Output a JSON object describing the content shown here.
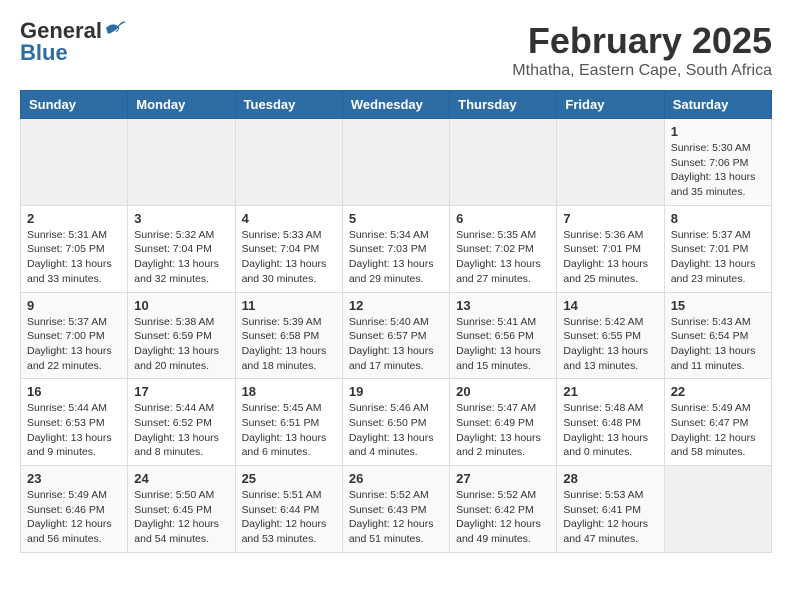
{
  "header": {
    "logo_general": "General",
    "logo_blue": "Blue",
    "month_title": "February 2025",
    "location": "Mthatha, Eastern Cape, South Africa"
  },
  "weekdays": [
    "Sunday",
    "Monday",
    "Tuesday",
    "Wednesday",
    "Thursday",
    "Friday",
    "Saturday"
  ],
  "weeks": [
    [
      {
        "day": "",
        "info": ""
      },
      {
        "day": "",
        "info": ""
      },
      {
        "day": "",
        "info": ""
      },
      {
        "day": "",
        "info": ""
      },
      {
        "day": "",
        "info": ""
      },
      {
        "day": "",
        "info": ""
      },
      {
        "day": "1",
        "info": "Sunrise: 5:30 AM\nSunset: 7:06 PM\nDaylight: 13 hours\nand 35 minutes."
      }
    ],
    [
      {
        "day": "2",
        "info": "Sunrise: 5:31 AM\nSunset: 7:05 PM\nDaylight: 13 hours\nand 33 minutes."
      },
      {
        "day": "3",
        "info": "Sunrise: 5:32 AM\nSunset: 7:04 PM\nDaylight: 13 hours\nand 32 minutes."
      },
      {
        "day": "4",
        "info": "Sunrise: 5:33 AM\nSunset: 7:04 PM\nDaylight: 13 hours\nand 30 minutes."
      },
      {
        "day": "5",
        "info": "Sunrise: 5:34 AM\nSunset: 7:03 PM\nDaylight: 13 hours\nand 29 minutes."
      },
      {
        "day": "6",
        "info": "Sunrise: 5:35 AM\nSunset: 7:02 PM\nDaylight: 13 hours\nand 27 minutes."
      },
      {
        "day": "7",
        "info": "Sunrise: 5:36 AM\nSunset: 7:01 PM\nDaylight: 13 hours\nand 25 minutes."
      },
      {
        "day": "8",
        "info": "Sunrise: 5:37 AM\nSunset: 7:01 PM\nDaylight: 13 hours\nand 23 minutes."
      }
    ],
    [
      {
        "day": "9",
        "info": "Sunrise: 5:37 AM\nSunset: 7:00 PM\nDaylight: 13 hours\nand 22 minutes."
      },
      {
        "day": "10",
        "info": "Sunrise: 5:38 AM\nSunset: 6:59 PM\nDaylight: 13 hours\nand 20 minutes."
      },
      {
        "day": "11",
        "info": "Sunrise: 5:39 AM\nSunset: 6:58 PM\nDaylight: 13 hours\nand 18 minutes."
      },
      {
        "day": "12",
        "info": "Sunrise: 5:40 AM\nSunset: 6:57 PM\nDaylight: 13 hours\nand 17 minutes."
      },
      {
        "day": "13",
        "info": "Sunrise: 5:41 AM\nSunset: 6:56 PM\nDaylight: 13 hours\nand 15 minutes."
      },
      {
        "day": "14",
        "info": "Sunrise: 5:42 AM\nSunset: 6:55 PM\nDaylight: 13 hours\nand 13 minutes."
      },
      {
        "day": "15",
        "info": "Sunrise: 5:43 AM\nSunset: 6:54 PM\nDaylight: 13 hours\nand 11 minutes."
      }
    ],
    [
      {
        "day": "16",
        "info": "Sunrise: 5:44 AM\nSunset: 6:53 PM\nDaylight: 13 hours\nand 9 minutes."
      },
      {
        "day": "17",
        "info": "Sunrise: 5:44 AM\nSunset: 6:52 PM\nDaylight: 13 hours\nand 8 minutes."
      },
      {
        "day": "18",
        "info": "Sunrise: 5:45 AM\nSunset: 6:51 PM\nDaylight: 13 hours\nand 6 minutes."
      },
      {
        "day": "19",
        "info": "Sunrise: 5:46 AM\nSunset: 6:50 PM\nDaylight: 13 hours\nand 4 minutes."
      },
      {
        "day": "20",
        "info": "Sunrise: 5:47 AM\nSunset: 6:49 PM\nDaylight: 13 hours\nand 2 minutes."
      },
      {
        "day": "21",
        "info": "Sunrise: 5:48 AM\nSunset: 6:48 PM\nDaylight: 13 hours\nand 0 minutes."
      },
      {
        "day": "22",
        "info": "Sunrise: 5:49 AM\nSunset: 6:47 PM\nDaylight: 12 hours\nand 58 minutes."
      }
    ],
    [
      {
        "day": "23",
        "info": "Sunrise: 5:49 AM\nSunset: 6:46 PM\nDaylight: 12 hours\nand 56 minutes."
      },
      {
        "day": "24",
        "info": "Sunrise: 5:50 AM\nSunset: 6:45 PM\nDaylight: 12 hours\nand 54 minutes."
      },
      {
        "day": "25",
        "info": "Sunrise: 5:51 AM\nSunset: 6:44 PM\nDaylight: 12 hours\nand 53 minutes."
      },
      {
        "day": "26",
        "info": "Sunrise: 5:52 AM\nSunset: 6:43 PM\nDaylight: 12 hours\nand 51 minutes."
      },
      {
        "day": "27",
        "info": "Sunrise: 5:52 AM\nSunset: 6:42 PM\nDaylight: 12 hours\nand 49 minutes."
      },
      {
        "day": "28",
        "info": "Sunrise: 5:53 AM\nSunset: 6:41 PM\nDaylight: 12 hours\nand 47 minutes."
      },
      {
        "day": "",
        "info": ""
      }
    ]
  ]
}
